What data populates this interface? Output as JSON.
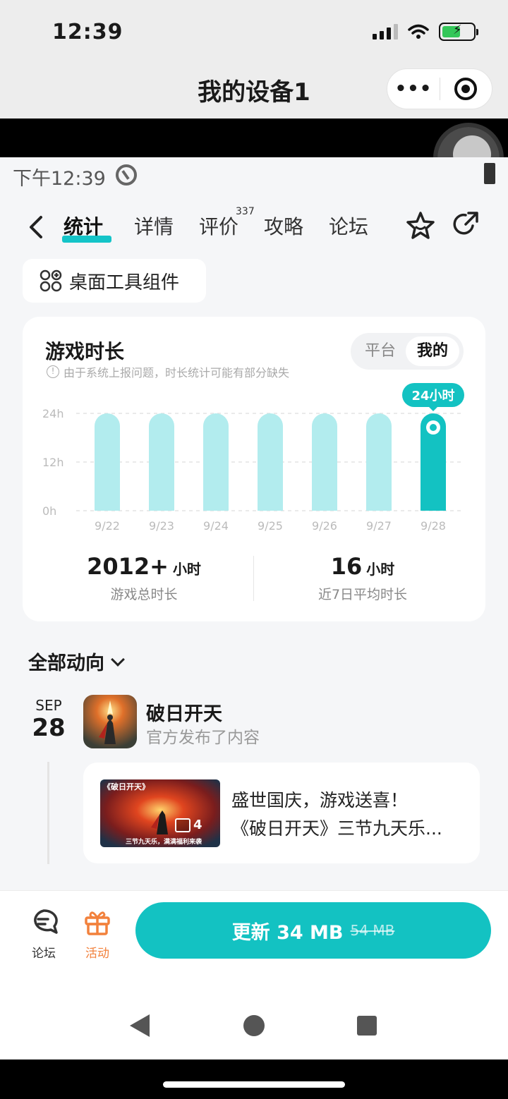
{
  "ios_status": {
    "time": "12:39"
  },
  "miniprogram": {
    "title": "我的设备1"
  },
  "android_status": {
    "time": "下午12:39"
  },
  "tabs": [
    {
      "label": "统计",
      "active": true
    },
    {
      "label": "详情"
    },
    {
      "label": "评价",
      "badge": "337"
    },
    {
      "label": "攻略"
    },
    {
      "label": "论坛"
    }
  ],
  "widget_button": {
    "label": "桌面工具组件"
  },
  "playtime_card": {
    "title": "游戏时长",
    "note": "由于系统上报问题，时长统计可能有部分缺失",
    "toggle": [
      "平台",
      "我的"
    ],
    "toggle_selected": "我的",
    "total": {
      "value": "2012+",
      "unit": "小时",
      "label": "游戏总时长"
    },
    "average": {
      "value": "16",
      "unit": "小时",
      "label": "近7日平均时长"
    }
  },
  "chart_data": {
    "type": "bar",
    "categories": [
      "9/22",
      "9/23",
      "9/24",
      "9/25",
      "9/26",
      "9/27",
      "9/28"
    ],
    "values": [
      24,
      24,
      24,
      24,
      24,
      24,
      24
    ],
    "y_ticks": [
      "24h",
      "12h",
      "0h"
    ],
    "ylim": [
      0,
      24
    ],
    "highlight_index": 6,
    "highlight_label": "24小时",
    "grid": true,
    "colors": {
      "bar": "#b2ecee",
      "highlight": "#13c2c2"
    }
  },
  "feed": {
    "header": "全部动向",
    "date_month": "SEP",
    "date_day": "28",
    "game_name": "破日开天",
    "game_sub": "官方发布了内容",
    "post_line1": "盛世国庆，游戏送喜！",
    "post_line2": "《破日开天》三节九天乐...",
    "thumb_count": "4",
    "thumb_title": "《破日开天》",
    "thumb_caption": "三节九天乐，满满福利来袭"
  },
  "bottom_bar": {
    "forum_label": "论坛",
    "activity_label": "活动",
    "update_label": "更新 34 MB",
    "update_old_size": "54 MB",
    "colors": {
      "accent": "#13c2c2",
      "activity": "#f2813c"
    }
  }
}
